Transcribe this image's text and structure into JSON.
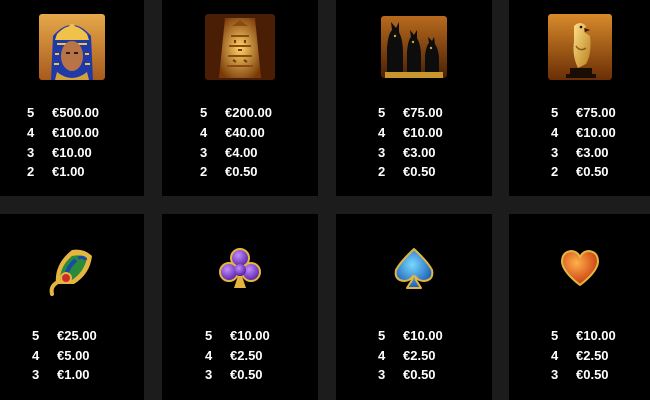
{
  "colors": {
    "background": "#1c1c1c",
    "cell": "#000000",
    "text": "#ffffff"
  },
  "symbols": [
    {
      "name": "pharaoh-symbol-icon",
      "pays": [
        [
          "5",
          "€500.00"
        ],
        [
          "4",
          "€100.00"
        ],
        [
          "3",
          "€10.00"
        ],
        [
          "2",
          "€1.00"
        ]
      ]
    },
    {
      "name": "golden-tablet-symbol-icon",
      "pays": [
        [
          "5",
          "€200.00"
        ],
        [
          "4",
          "€40.00"
        ],
        [
          "3",
          "€4.00"
        ],
        [
          "2",
          "€0.50"
        ]
      ]
    },
    {
      "name": "black-cats-symbol-icon",
      "pays": [
        [
          "5",
          "€75.00"
        ],
        [
          "4",
          "€10.00"
        ],
        [
          "3",
          "€3.00"
        ],
        [
          "2",
          "€0.50"
        ]
      ]
    },
    {
      "name": "golden-falcon-symbol-icon",
      "pays": [
        [
          "5",
          "€75.00"
        ],
        [
          "4",
          "€10.00"
        ],
        [
          "3",
          "€3.00"
        ],
        [
          "2",
          "€0.50"
        ]
      ]
    },
    {
      "name": "lotus-flower-symbol-icon",
      "pays": [
        [
          "5",
          "€25.00"
        ],
        [
          "4",
          "€5.00"
        ],
        [
          "3",
          "€1.00"
        ]
      ]
    },
    {
      "name": "club-symbol-icon",
      "pays": [
        [
          "5",
          "€10.00"
        ],
        [
          "4",
          "€2.50"
        ],
        [
          "3",
          "€0.50"
        ]
      ]
    },
    {
      "name": "spade-symbol-icon",
      "pays": [
        [
          "5",
          "€10.00"
        ],
        [
          "4",
          "€2.50"
        ],
        [
          "3",
          "€0.50"
        ]
      ]
    },
    {
      "name": "heart-symbol-icon",
      "pays": [
        [
          "5",
          "€10.00"
        ],
        [
          "4",
          "€2.50"
        ],
        [
          "3",
          "€0.50"
        ]
      ]
    }
  ]
}
